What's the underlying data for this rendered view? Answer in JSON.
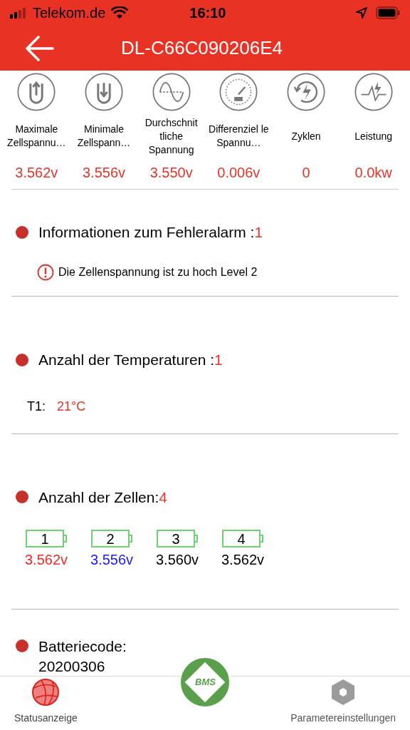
{
  "status_bar": {
    "carrier": "Telekom.de",
    "time": "16:10"
  },
  "header": {
    "title": "DL-C66C090206E4"
  },
  "metrics": [
    {
      "kind": "max",
      "label": "Maximale Zellspannu…",
      "value": "3.562v"
    },
    {
      "kind": "min",
      "label": "Minimale Zellspann…",
      "value": "3.556v"
    },
    {
      "kind": "avg",
      "label": "Durchschnit tliche Spannung",
      "value": "3.550v"
    },
    {
      "kind": "diff",
      "label": "Differenziel le Spannu…",
      "value": "0.006v"
    },
    {
      "kind": "cycles",
      "label": "Zyklen",
      "value": "0"
    },
    {
      "kind": "power",
      "label": "Leistung",
      "value": "0.0kw"
    }
  ],
  "alarm": {
    "title": "Informationen zum Fehleralarm :",
    "count": "1",
    "items": [
      "Die Zellenspannung ist zu hoch Level 2"
    ]
  },
  "temperatures": {
    "title": "Anzahl der Temperaturen :",
    "count": "1",
    "items": [
      {
        "label": "T1:",
        "value": "21°C"
      }
    ]
  },
  "cells": {
    "title": "Anzahl der Zellen:",
    "count": "4",
    "items": [
      {
        "index": "1",
        "voltage": "3.562v",
        "color": "#ee2b24"
      },
      {
        "index": "2",
        "voltage": "3.556v",
        "color": "#1a1aff"
      },
      {
        "index": "3",
        "voltage": "3.560v",
        "color": "#000000"
      },
      {
        "index": "4",
        "voltage": "3.562v",
        "color": "#000000"
      }
    ]
  },
  "battery_code": {
    "title": "Batteriecode:",
    "value": "20200306"
  },
  "tab_bar": {
    "logo": "BMS",
    "tabs": [
      {
        "label": "Statusanzeige",
        "selected": true
      },
      {
        "label": "Parametereinstellungen",
        "selected": false
      }
    ]
  }
}
